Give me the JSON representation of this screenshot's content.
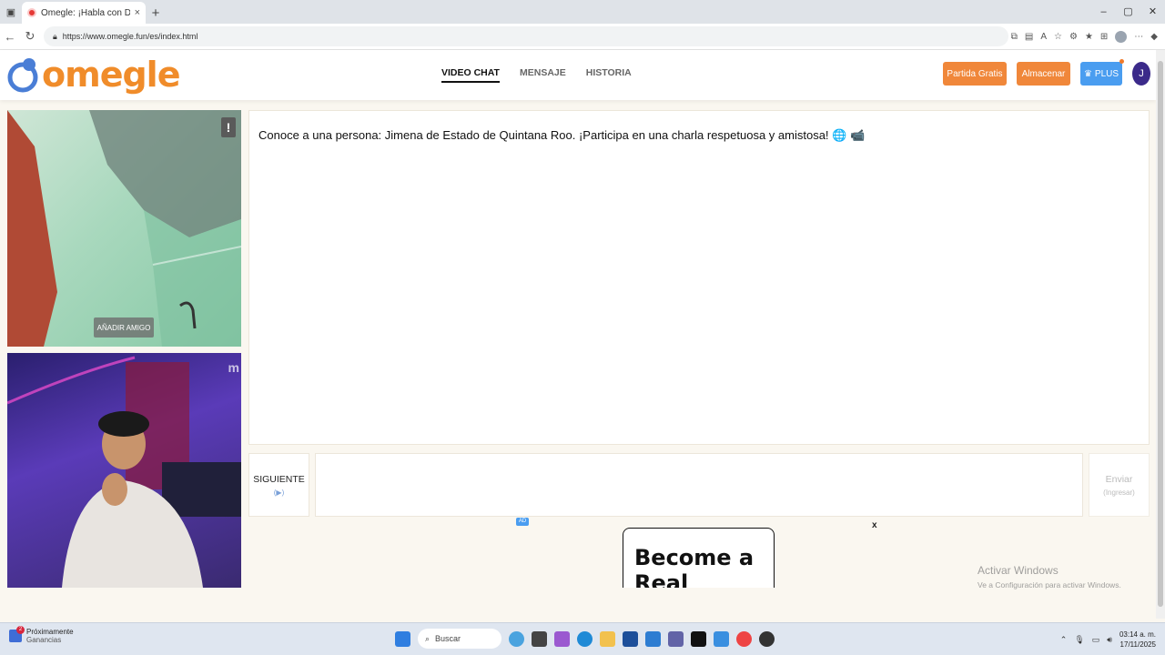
{
  "browser": {
    "tab_title": "Omegle: ¡Habla con Descon",
    "tab_close": "×",
    "new_tab": "+",
    "url": "https://www.omegle.fun/es/index.html",
    "win_min": "–",
    "win_max": "▢",
    "win_close": "✕"
  },
  "site": {
    "logo_text": "omegle",
    "nav": [
      {
        "label": "VIDEO CHAT",
        "active": true
      },
      {
        "label": "MENSAJE",
        "active": false
      },
      {
        "label": "HISTORIA",
        "active": false
      }
    ],
    "btn_partida": "Partida Gratis",
    "btn_almacenar": "Almacenar",
    "btn_plus": "PLUS",
    "user_initial": "J"
  },
  "video": {
    "report_label": "!",
    "add_friend": "AÑADIR AMIGO",
    "watermark": "m"
  },
  "chat": {
    "message": "Conoce a una persona: Jimena de Estado de Quintana Roo. ¡Participa en una charla respetuosa y amistosa! 🌐 📹",
    "next_label": "SIGUIENTE",
    "next_sub": "(▶)",
    "send_label": "Enviar",
    "send_sub": "(Ingresar)"
  },
  "ad": {
    "badge": "AD",
    "close": "x",
    "title": "Become a Real Legend"
  },
  "windows": {
    "activate_title": "Activar Windows",
    "activate_sub": "Ve a Configuración para activar Windows."
  },
  "taskbar": {
    "weather_badge": "2",
    "weather_title": "Próximamente",
    "weather_sub": "Ganancias",
    "search": "Buscar",
    "time": "03:14 a. m.",
    "date": "17/11/2025"
  },
  "colors": {
    "accent_orange": "#f0873a",
    "plus_blue": "#4a9df0",
    "avatar_purple": "#3b2a8a"
  }
}
